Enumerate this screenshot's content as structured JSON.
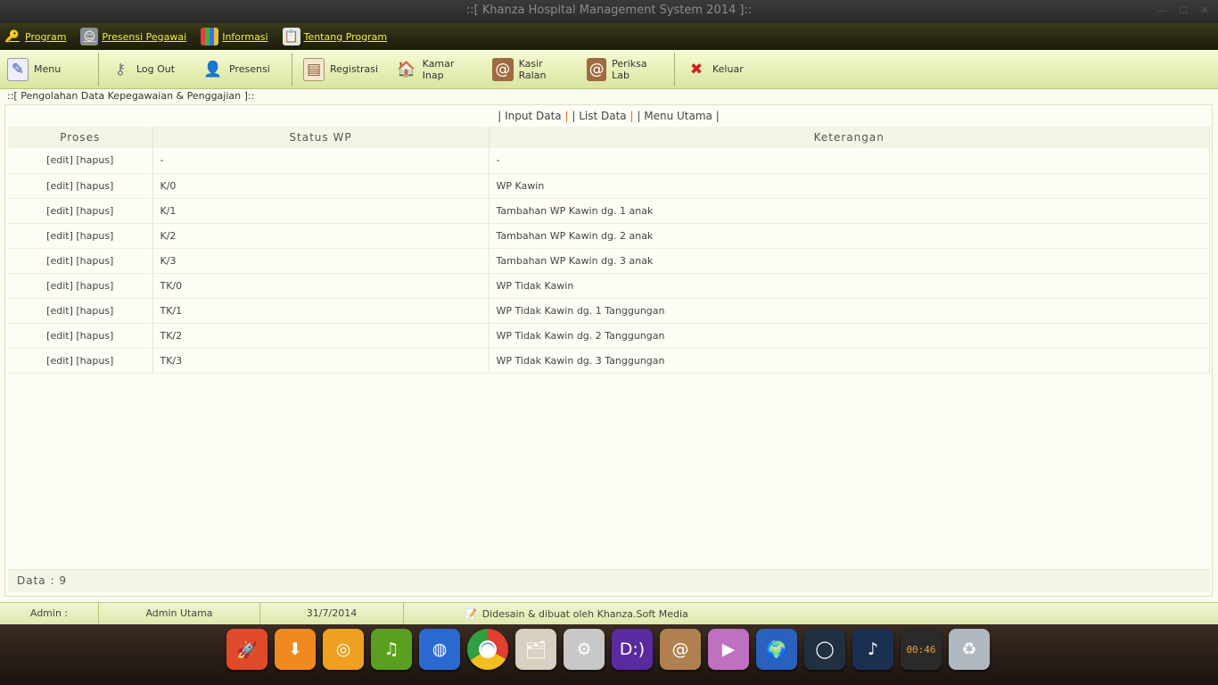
{
  "window": {
    "title": "::[ Khanza Hospital Management System 2014 ]::"
  },
  "menubar": {
    "items": [
      {
        "label": "Program",
        "icon": "key-icon"
      },
      {
        "label": "Presensi Pegawai",
        "icon": "employee-icon"
      },
      {
        "label": "Informasi",
        "icon": "chart-icon"
      },
      {
        "label": "Tentang Program",
        "icon": "clipboard-icon"
      }
    ]
  },
  "toolbar": {
    "menu": "Menu",
    "logout": "Log Out",
    "presensi": "Presensi",
    "registrasi": "Registrasi",
    "kamar_inap": "Kamar Inap",
    "kasir_ralan": "Kasir Ralan",
    "periksa_lab": "Periksa Lab",
    "keluar": "Keluar"
  },
  "panel": {
    "title": "::[ Pengolahan Data Kepegawaian & Penggajian ]::",
    "links": {
      "input_data": "Input Data",
      "list_data": "List Data",
      "menu_utama": "Menu Utama",
      "sep": "|"
    },
    "table": {
      "headers": [
        "Proses",
        "Status WP",
        "Keterangan"
      ],
      "edit_label": "[edit]",
      "hapus_label": "[hapus]",
      "rows": [
        {
          "status": "-",
          "keterangan": "-"
        },
        {
          "status": "K/0",
          "keterangan": "WP Kawin"
        },
        {
          "status": "K/1",
          "keterangan": "Tambahan WP Kawin dg. 1 anak"
        },
        {
          "status": "K/2",
          "keterangan": "Tambahan WP Kawin dg. 2 anak"
        },
        {
          "status": "K/3",
          "keterangan": "Tambahan WP Kawin dg. 3 anak"
        },
        {
          "status": "TK/0",
          "keterangan": "WP Tidak Kawin"
        },
        {
          "status": "TK/1",
          "keterangan": "WP Tidak Kawin dg. 1 Tanggungan"
        },
        {
          "status": "TK/2",
          "keterangan": "WP Tidak Kawin dg. 2 Tanggungan"
        },
        {
          "status": "TK/3",
          "keterangan": "WP Tidak Kawin dg. 3 Tanggungan"
        }
      ]
    },
    "data_count": "Data : 9"
  },
  "statusbar": {
    "admin_label": "Admin :",
    "user": "Admin Utama",
    "date": "31/7/2014",
    "credit": "Didesain & dibuat oleh Khanza.Soft Media"
  },
  "dock": {
    "clock": "00:46",
    "icons": [
      "rocket-icon",
      "installer-icon",
      "swirl-app-icon",
      "music-note-icon",
      "globe-browser-icon",
      "chrome-icon",
      "file-manager-icon",
      "settings-icon",
      "deepin-icon",
      "address-book-icon",
      "video-player-icon",
      "earth-icon",
      "media-ring-icon",
      "deepin-music-icon",
      "clock-icon",
      "trash-icon"
    ]
  },
  "colors": {
    "menubar_text": "#f2ee3a",
    "toolbar_bg": "#e7f0b8",
    "panel_bg": "#fafcef",
    "link_separator": "#e07020"
  }
}
